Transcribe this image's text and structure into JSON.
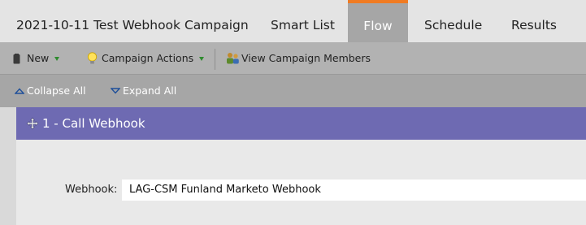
{
  "tabs": [
    {
      "label": "2021-10-11 Test Webhook Campaign"
    },
    {
      "label": "Smart List"
    },
    {
      "label": "Flow"
    },
    {
      "label": "Schedule"
    },
    {
      "label": "Results"
    }
  ],
  "toolbar": {
    "new_label": "New",
    "campaign_actions_label": "Campaign Actions",
    "view_members_label": "View Campaign Members"
  },
  "subbar": {
    "collapse_label": "Collapse All",
    "expand_label": "Expand All"
  },
  "step": {
    "title": "1 - Call Webhook",
    "webhook_label": "Webhook:",
    "webhook_value": "LAG-CSM Funland Marketo Webhook"
  },
  "colors": {
    "tab_active_accent": "#f07b22",
    "step_header": "#6e6ab2",
    "dropdown_caret": "#2e8b2e"
  }
}
